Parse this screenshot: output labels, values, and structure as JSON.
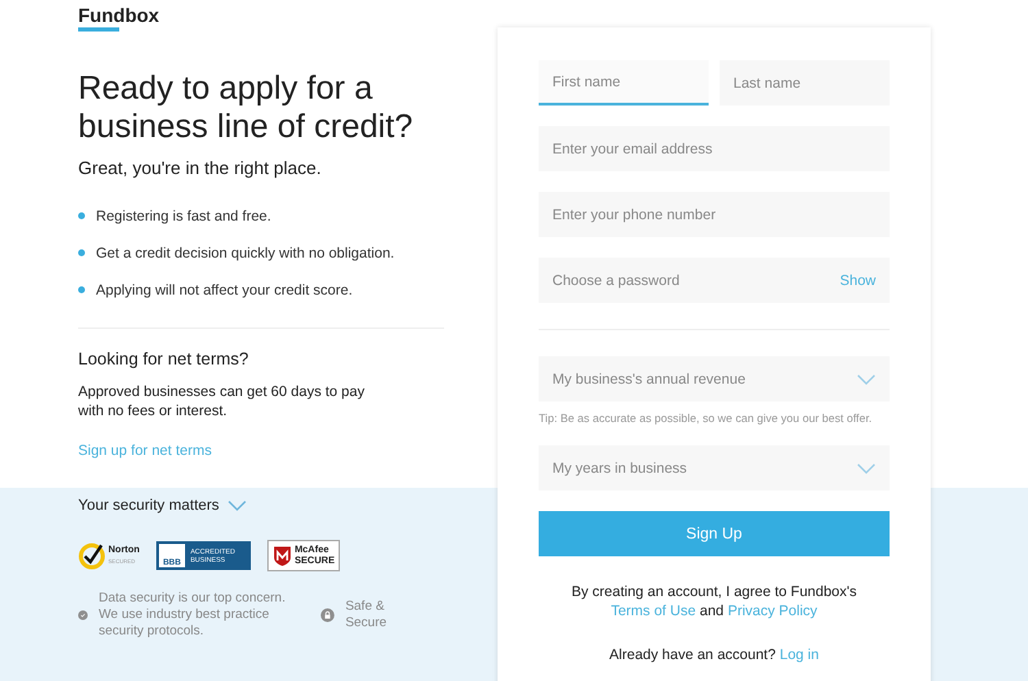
{
  "logo": "Fundbox",
  "heading": "Ready to apply for a business line of credit?",
  "subtitle": "Great, you're in the right place.",
  "benefits": [
    "Registering is fast and free.",
    "Get a credit decision quickly with no obligation.",
    "Applying will not affect your credit score."
  ],
  "net_terms": {
    "title": "Looking for net terms?",
    "text": "Approved businesses can get 60 days to pay with no fees or interest.",
    "link": "Sign up for net terms"
  },
  "security": {
    "title": "Your security matters",
    "expanded": false,
    "badges": [
      {
        "kind": "norton",
        "texts": [
          "Norton",
          "SECURED"
        ]
      },
      {
        "kind": "bbb",
        "texts": [
          "BBB",
          "ACCREDITED BUSINESS"
        ]
      },
      {
        "kind": "mcafee",
        "texts": [
          "McAfee",
          "SECURE"
        ]
      }
    ],
    "notes": [
      {
        "kind": "check",
        "text": "Data security is our top concern. We use industry best practice security protocols."
      },
      {
        "kind": "lock",
        "text": "Safe & Secure"
      }
    ]
  },
  "form": {
    "name_fields": [
      {
        "placeholder": "First name",
        "focused": true
      },
      {
        "placeholder": "Last name",
        "focused": false
      }
    ],
    "fields": [
      {
        "kind": "text",
        "placeholder": "Enter your email address"
      },
      {
        "kind": "text",
        "placeholder": "Enter your phone number"
      },
      {
        "kind": "password",
        "placeholder": "Choose a password",
        "toggle": "Show"
      },
      {
        "kind": "divider"
      },
      {
        "kind": "select",
        "placeholder": "My business's annual revenue",
        "tip": "Tip: Be as accurate as possible, so we can give you our best offer."
      },
      {
        "kind": "select",
        "placeholder": "My years in business"
      }
    ],
    "submit": "Sign Up",
    "agreement": "By creating an account, I agree to Fundbox's",
    "terms_link": "Terms of Use",
    "and": "and",
    "privacy_link": "Privacy Policy",
    "login_prompt": "Already have an account?",
    "login_link": "Log in"
  }
}
